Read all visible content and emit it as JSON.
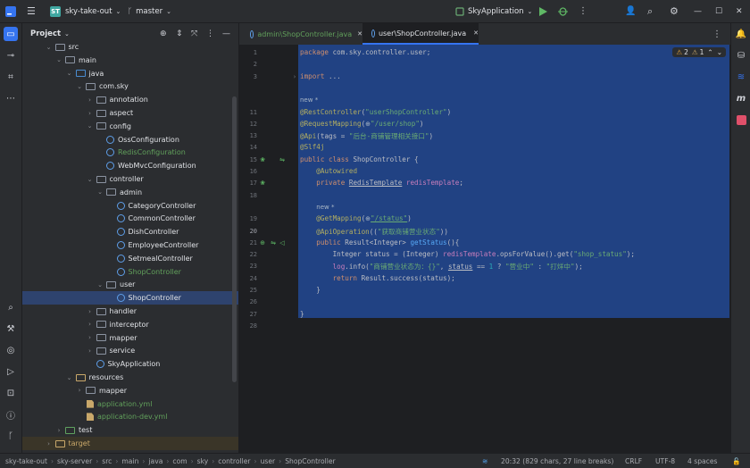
{
  "titlebar": {
    "project_badge": "ST",
    "project_name": "sky-take-out",
    "branch": "master",
    "run_config": "SkyApplication"
  },
  "project_panel": {
    "title": "Project",
    "tree": [
      {
        "label": "src",
        "kind": "folder",
        "depth": 3,
        "expanded": true
      },
      {
        "label": "main",
        "kind": "folder",
        "depth": 4,
        "expanded": true
      },
      {
        "label": "java",
        "kind": "src",
        "depth": 5,
        "expanded": true
      },
      {
        "label": "com.sky",
        "kind": "pkg",
        "depth": 6,
        "expanded": true
      },
      {
        "label": "annotation",
        "kind": "pkg",
        "depth": 7,
        "expanded": false
      },
      {
        "label": "aspect",
        "kind": "pkg",
        "depth": 7,
        "expanded": false
      },
      {
        "label": "config",
        "kind": "pkg",
        "depth": 7,
        "expanded": true
      },
      {
        "label": "OssConfiguration",
        "kind": "class",
        "depth": 8
      },
      {
        "label": "RedisConfiguration",
        "kind": "class",
        "depth": 8,
        "state": "modified"
      },
      {
        "label": "WebMvcConfiguration",
        "kind": "class",
        "depth": 8
      },
      {
        "label": "controller",
        "kind": "pkg",
        "depth": 7,
        "expanded": true
      },
      {
        "label": "admin",
        "kind": "pkg",
        "depth": 8,
        "expanded": true
      },
      {
        "label": "CategoryController",
        "kind": "class",
        "depth": 9
      },
      {
        "label": "CommonController",
        "kind": "class",
        "depth": 9
      },
      {
        "label": "DishController",
        "kind": "class",
        "depth": 9
      },
      {
        "label": "EmployeeController",
        "kind": "class",
        "depth": 9
      },
      {
        "label": "SetmealController",
        "kind": "class",
        "depth": 9
      },
      {
        "label": "ShopController",
        "kind": "class",
        "depth": 9,
        "state": "modified"
      },
      {
        "label": "user",
        "kind": "pkg",
        "depth": 8,
        "expanded": true
      },
      {
        "label": "ShopController",
        "kind": "class",
        "depth": 9,
        "state": "selected"
      },
      {
        "label": "handler",
        "kind": "pkg",
        "depth": 7,
        "expanded": false
      },
      {
        "label": "interceptor",
        "kind": "pkg",
        "depth": 7,
        "expanded": false
      },
      {
        "label": "mapper",
        "kind": "pkg",
        "depth": 7,
        "expanded": false
      },
      {
        "label": "service",
        "kind": "pkg",
        "depth": 7,
        "expanded": false
      },
      {
        "label": "SkyApplication",
        "kind": "class",
        "depth": 7
      },
      {
        "label": "resources",
        "kind": "res",
        "depth": 5,
        "expanded": true
      },
      {
        "label": "mapper",
        "kind": "folder",
        "depth": 6,
        "expanded": false
      },
      {
        "label": "application.yml",
        "kind": "yml",
        "depth": 6,
        "state": "modified"
      },
      {
        "label": "application-dev.yml",
        "kind": "yml",
        "depth": 6,
        "state": "modified"
      },
      {
        "label": "test",
        "kind": "test",
        "depth": 4,
        "expanded": false
      },
      {
        "label": "target",
        "kind": "excluded",
        "depth": 3,
        "expanded": false
      }
    ]
  },
  "tabs": [
    {
      "label": "admin\\ShopController.java",
      "active": false
    },
    {
      "label": "user\\ShopController.java",
      "active": true
    }
  ],
  "inspections": {
    "warnings": "2",
    "weak_warnings": "1"
  },
  "code_lines": [
    {
      "num": "1",
      "html": "<span class='kw'>package</span> com.sky.controller.user;"
    },
    {
      "num": "2",
      "html": ""
    },
    {
      "num": "3",
      "html": "<span class='kw'>import</span> ..."
    },
    {
      "num": "",
      "html": ""
    },
    {
      "num": "",
      "html": "<span class='hint'>new *</span>"
    },
    {
      "num": "11",
      "html": "<span class='ann'>@RestController</span>(<span class='str'>\"userShopController\"</span>)"
    },
    {
      "num": "12",
      "html": "<span class='ann'>@RequestMapping</span>(<span class='hint'>⊕</span><span class='str'>\"/user/shop\"</span>)"
    },
    {
      "num": "13",
      "html": "<span class='ann'>@Api</span>(tags = <span class='str'>\"后台-商铺管理相关接口\"</span>)"
    },
    {
      "num": "14",
      "html": "<span class='ann'>@Slf4j</span>"
    },
    {
      "num": "15",
      "html": "<span class='kw'>public class</span> ShopController {"
    },
    {
      "num": "16",
      "html": "    <span class='ann'>@Autowired</span>"
    },
    {
      "num": "17",
      "html": "    <span class='kw'>private</span> <span class='link'>RedisTemplate</span> <span class='fld'>redisTemplate</span>;"
    },
    {
      "num": "18",
      "html": ""
    },
    {
      "num": "",
      "html": "    <span class='hint'>new *</span>"
    },
    {
      "num": "19",
      "html": "    <span class='ann'>@GetMapping</span>(<span class='hint'>⊕</span><span class='str link'>\"/status\"</span>)"
    },
    {
      "num": "20",
      "html": "    <span class='ann'>@ApiOperation</span>((<span class='str'>\"获取商铺营业状态\"</span>))"
    },
    {
      "num": "21",
      "html": "    <span class='kw'>public</span> Result&lt;Integer&gt; <span class='fn'>getStatus</span>(){"
    },
    {
      "num": "22",
      "html": "        Integer status = (Integer) <span class='fld'>redisTemplate</span>.opsForValue().get(<span class='str'>\"shop_status\"</span>);"
    },
    {
      "num": "23",
      "html": "        <span class='fld'>log</span>.info(<span class='str'>\"商铺营业状态为：{}\"</span>, <span class='link'>status</span> == <span class='num'>1</span> ? <span class='str'>\"营业中\"</span> : <span class='str'>\"打烊中\"</span>);"
    },
    {
      "num": "24",
      "html": "        <span class='kw'>return</span> Result.success(status);"
    },
    {
      "num": "25",
      "html": "    }"
    },
    {
      "num": "26",
      "html": ""
    },
    {
      "num": "27",
      "html": "}"
    },
    {
      "num": "28",
      "html": ""
    }
  ],
  "breadcrumb": [
    "sky-take-out",
    "sky-server",
    "src",
    "main",
    "java",
    "com",
    "sky",
    "controller",
    "user",
    "ShopController"
  ],
  "status": {
    "position": "20:32 (829 chars, 27 line breaks)",
    "line_sep": "CRLF",
    "encoding": "UTF-8",
    "indent": "4 spaces"
  }
}
